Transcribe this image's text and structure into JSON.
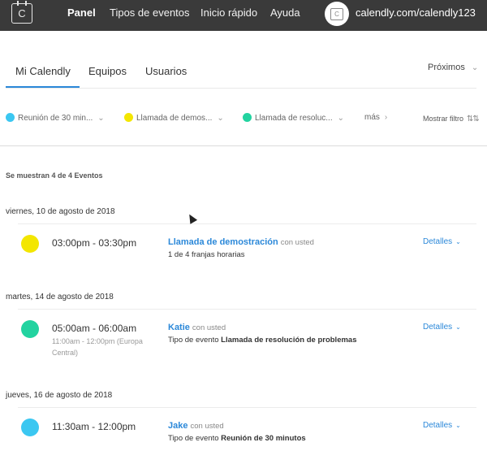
{
  "topbar": {
    "logo_glyph": "C",
    "nav": [
      "Panel",
      "Tipos de eventos",
      "Inicio rápido",
      "Ayuda"
    ],
    "url": "calendly.com/calendly123",
    "avatar_glyph": "C"
  },
  "tabs": [
    "Mi Calendly",
    "Equipos",
    "Usuarios"
  ],
  "upcoming_label": "Próximos",
  "filters": [
    {
      "label": "Reunión de 30 min...",
      "color": "#3bc7f1"
    },
    {
      "label": "Llamada de demos...",
      "color": "#f3e600"
    },
    {
      "label": "Llamada de resoluc...",
      "color": "#22d3a0"
    }
  ],
  "more_label": "más",
  "show_filter_label": "Mostrar filtro",
  "count_text": "Se muestran 4 de 4 Eventos",
  "days": [
    {
      "date": "viernes, 10 de agosto de 2018",
      "event": {
        "color": "#f3e600",
        "time": "03:00pm - 03:30pm",
        "timezone": "",
        "title": "Llamada de demostración",
        "with": "con usted",
        "sub_prefix": "1 de 4 franjas horarias",
        "sub_bold": "",
        "details": "Detalles"
      }
    },
    {
      "date": "martes, 14 de agosto de 2018",
      "event": {
        "color": "#22d3a0",
        "time": "05:00am - 06:00am",
        "timezone": "11:00am - 12:00pm (Europa Central)",
        "title": "Katie",
        "with": "con usted",
        "sub_prefix": "Tipo de evento",
        "sub_bold": "Llamada de resolución de problemas",
        "details": "Detalles"
      }
    },
    {
      "date": "jueves, 16 de agosto de 2018",
      "event": {
        "color": "#3bc7f1",
        "time": "11:30am - 12:00pm",
        "timezone": "",
        "title": "Jake",
        "with": "con usted",
        "sub_prefix": "Tipo de evento",
        "sub_bold": "Reunión de 30 minutos",
        "details": "Detalles"
      }
    }
  ]
}
